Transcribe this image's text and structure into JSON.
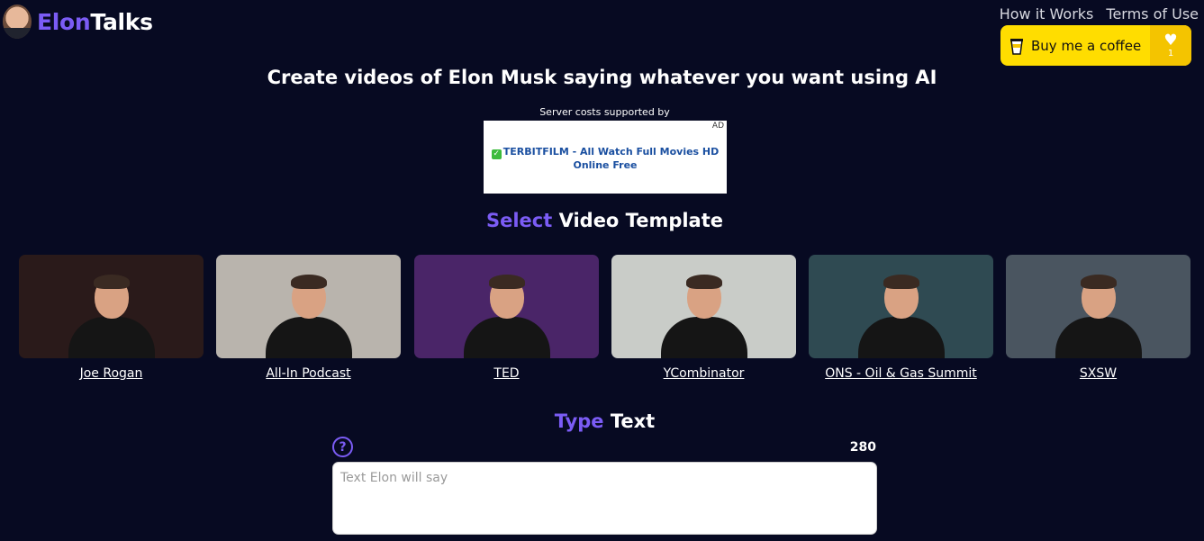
{
  "brand": {
    "part1": "Elon",
    "part2": "Talks"
  },
  "nav": {
    "how_it_works": "How it Works",
    "terms": "Terms of Use"
  },
  "coffee": {
    "label": "Buy me a coffee",
    "count": "1"
  },
  "headline": "Create videos of Elon Musk saying whatever you want using AI",
  "sponsor_label": "Server costs supported by",
  "ad": {
    "badge": "AD",
    "text": "TERBITFILM - All Watch Full Movies HD Online Free"
  },
  "select_section": {
    "accent": "Select",
    "rest": " Video Template"
  },
  "templates": [
    {
      "label": "Joe Rogan",
      "bg": "#2a1a1a"
    },
    {
      "label": "All-In Podcast",
      "bg": "#b9b4ad"
    },
    {
      "label": "TED",
      "bg": "#4a2568"
    },
    {
      "label": "YCombinator",
      "bg": "#c9ccc8"
    },
    {
      "label": "ONS - Oil & Gas Summit",
      "bg": "#2f4a52"
    },
    {
      "label": "SXSW",
      "bg": "#4a5560"
    }
  ],
  "type_section": {
    "accent": "Type",
    "rest": " Text"
  },
  "help_icon": "?",
  "char_count": "280",
  "textbox": {
    "placeholder": "Text Elon will say"
  },
  "colors": {
    "background": "#070a22",
    "accent": "#7b5cf5",
    "coffee": "#ffdd00"
  }
}
